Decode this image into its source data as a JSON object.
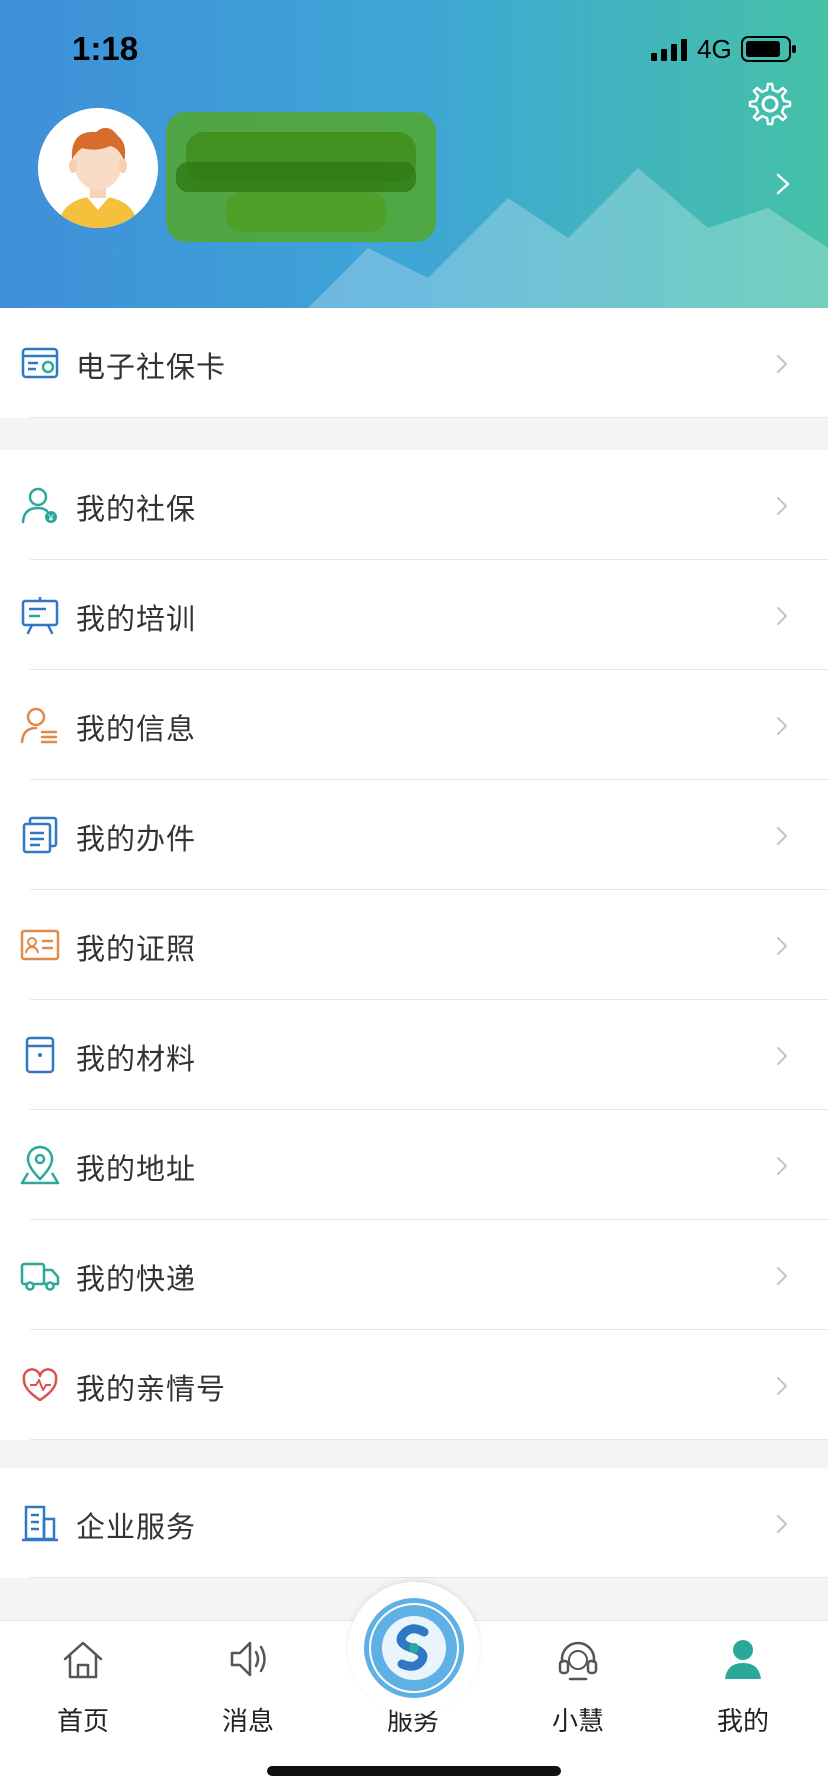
{
  "status_bar": {
    "time": "1:18",
    "network": "4G"
  },
  "colors": {
    "accent": "#3ea6d6",
    "green": "#45c1a7",
    "blue": "#2f78c4",
    "orange": "#e0894a",
    "red": "#d9534f",
    "teal": "#2aa89a"
  },
  "header": {
    "settings_icon": "gear-icon"
  },
  "menu": {
    "social_card": {
      "label": "电子社保卡",
      "icon": "id-card-icon"
    },
    "items": [
      {
        "label": "我的社保",
        "icon": "person-shield-icon"
      },
      {
        "label": "我的培训",
        "icon": "presentation-board-icon"
      },
      {
        "label": "我的信息",
        "icon": "person-list-icon"
      },
      {
        "label": "我的办件",
        "icon": "documents-icon"
      },
      {
        "label": "我的证照",
        "icon": "license-icon"
      },
      {
        "label": "我的材料",
        "icon": "folder-icon"
      },
      {
        "label": "我的地址",
        "icon": "location-pin-icon"
      },
      {
        "label": "我的快递",
        "icon": "delivery-truck-icon"
      },
      {
        "label": "我的亲情号",
        "icon": "heart-icon"
      }
    ],
    "enterprise": {
      "label": "企业服务",
      "icon": "building-icon"
    }
  },
  "tabbar": {
    "tabs": [
      {
        "label": "首页",
        "icon": "home-icon"
      },
      {
        "label": "消息",
        "icon": "speaker-icon"
      },
      {
        "label": "服务",
        "icon": "service-logo-icon"
      },
      {
        "label": "小慧",
        "icon": "headset-icon"
      },
      {
        "label": "我的",
        "icon": "user-icon"
      }
    ]
  }
}
